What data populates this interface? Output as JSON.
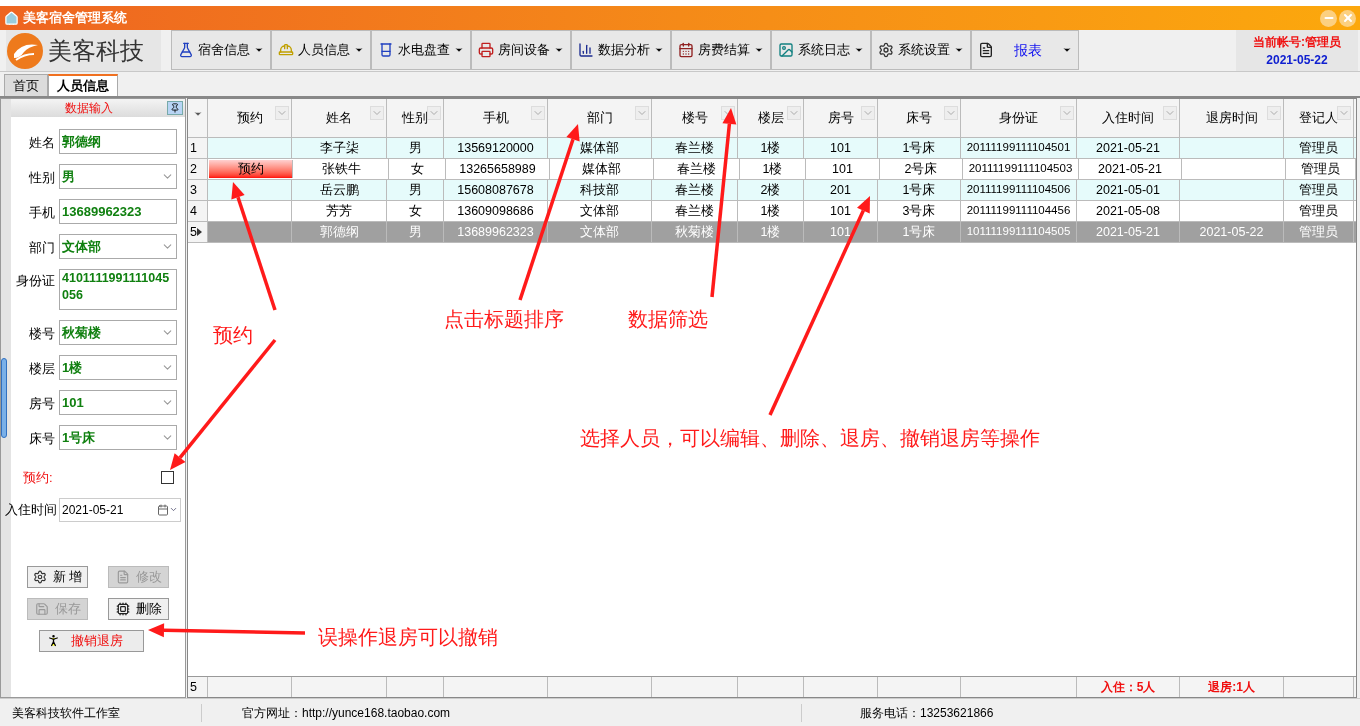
{
  "window": {
    "title": "美客宿舍管理系统"
  },
  "logo": {
    "text": "美客科技"
  },
  "menus": [
    {
      "label": "宿舍信息",
      "kind": "menu"
    },
    {
      "label": "人员信息",
      "kind": "menu"
    },
    {
      "label": "水电盘查",
      "kind": "menu"
    },
    {
      "label": "房间设备",
      "kind": "menu"
    },
    {
      "label": "数据分析",
      "kind": "menu"
    },
    {
      "label": "房费结算",
      "kind": "menu"
    },
    {
      "label": "系统日志",
      "kind": "menu"
    },
    {
      "label": "系统设置",
      "kind": "menu"
    },
    {
      "label": "报表",
      "kind": "report"
    }
  ],
  "account": {
    "user": "当前帐号:管理员",
    "date": "2021-05-22"
  },
  "tabs": [
    {
      "label": "首页",
      "selected": false
    },
    {
      "label": "人员信息",
      "selected": true
    }
  ],
  "form": {
    "title": "数据输入",
    "fields": [
      {
        "label": "姓名",
        "value": "郭德纲",
        "kind": "text"
      },
      {
        "label": "性别",
        "value": "男",
        "kind": "select"
      },
      {
        "label": "手机",
        "value": "13689962323",
        "kind": "text"
      },
      {
        "label": "部门",
        "value": "文体部",
        "kind": "select"
      },
      {
        "label": "身份证",
        "value": "4101111991111045056",
        "kind": "multiline"
      },
      {
        "label": "楼号",
        "value": "秋菊楼",
        "kind": "select"
      },
      {
        "label": "楼层",
        "value": "1楼",
        "kind": "select"
      },
      {
        "label": "房号",
        "value": "101",
        "kind": "select"
      },
      {
        "label": "床号",
        "value": "1号床",
        "kind": "select"
      }
    ],
    "reserve": {
      "label": "预约:",
      "checked": false
    },
    "checkin": {
      "label": "入住时间",
      "value": "2021-05-21"
    },
    "buttons": [
      {
        "label": "新 增",
        "disabled": false
      },
      {
        "label": "修改",
        "disabled": true
      },
      {
        "label": "保存",
        "disabled": true
      },
      {
        "label": "删除",
        "disabled": false
      }
    ],
    "undo_button": {
      "label": "撤销退房"
    }
  },
  "table": {
    "columns": [
      "预约",
      "姓名",
      "性别",
      "手机",
      "部门",
      "楼号",
      "楼层",
      "房号",
      "床号",
      "身份证",
      "入住时间",
      "退房时间",
      "登记人"
    ],
    "rows": [
      {
        "index": "1",
        "selected": false,
        "cells": [
          null,
          "李子柒",
          "男",
          "13569120000",
          "媒体部",
          "春兰楼",
          "1楼",
          "101",
          "1号床",
          "20111199111104501",
          "2021-05-21",
          null,
          "管理员"
        ]
      },
      {
        "index": "2",
        "selected": false,
        "reserved": true,
        "cells": [
          "预约",
          "张铁牛",
          "女",
          "13265658989",
          "媒体部",
          "春兰楼",
          "1楼",
          "101",
          "2号床",
          "20111199111104503",
          "2021-05-21",
          null,
          "管理员"
        ]
      },
      {
        "index": "3",
        "selected": false,
        "cells": [
          null,
          "岳云鹏",
          "男",
          "15608087678",
          "科技部",
          "春兰楼",
          "2楼",
          "201",
          "1号床",
          "20111199111104506",
          "2021-05-01",
          null,
          "管理员"
        ]
      },
      {
        "index": "4",
        "selected": false,
        "cells": [
          null,
          "芳芳",
          "女",
          "13609098686",
          "文体部",
          "春兰楼",
          "1楼",
          "101",
          "3号床",
          "20111199111104456",
          "2021-05-08",
          null,
          "管理员"
        ]
      },
      {
        "index": "5",
        "selected": true,
        "cells": [
          null,
          "郭德纲",
          "男",
          "13689962323",
          "文体部",
          "秋菊楼",
          "1楼",
          "101",
          "1号床",
          "10111199111104505",
          "2021-05-21",
          "2021-05-22",
          "管理员"
        ]
      }
    ],
    "footer": {
      "count": "5",
      "checked_in": "入住：5人",
      "checked_out": "退房:1人"
    }
  },
  "annotations": [
    "预约",
    "点击标题排序",
    "数据筛选",
    "选择人员，可以编辑、删除、退房、撤销退房等操作",
    "误操作退房可以撤销"
  ],
  "status_bar": [
    "美客科技软件工作室",
    "官方网址：http://yunce168.taobao.com",
    "服务电话：13253621866"
  ]
}
